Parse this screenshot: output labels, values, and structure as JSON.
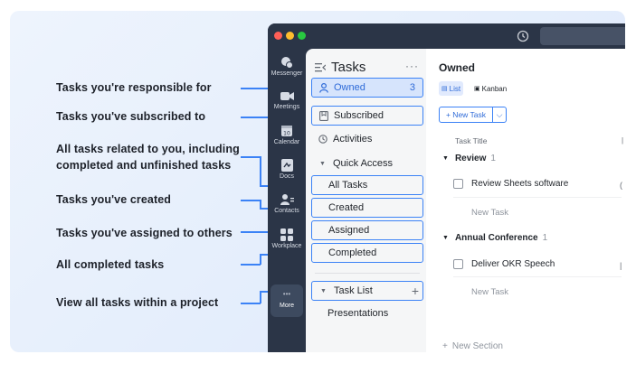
{
  "callouts": [
    "Tasks you're responsible for",
    "Tasks you've subscribed to",
    "All tasks related to you, including",
    "completed and unfinished tasks",
    "Tasks you've created",
    "Tasks you've assigned to others",
    "All completed tasks",
    "View all tasks within a project"
  ],
  "colors": {
    "accent": "#3b82f6",
    "traffic_red": "#ff5f57",
    "traffic_yellow": "#febc2e",
    "traffic_green": "#28c840"
  },
  "rail": {
    "items": [
      {
        "label": "Messenger",
        "icon": "messenger-icon"
      },
      {
        "label": "Meetings",
        "icon": "video-camera-icon"
      },
      {
        "label": "Calendar",
        "icon": "calendar-icon",
        "badge": "10"
      },
      {
        "label": "Docs",
        "icon": "docs-icon"
      },
      {
        "label": "Contacts",
        "icon": "contacts-icon"
      },
      {
        "label": "Workplace",
        "icon": "workplace-grid-icon"
      }
    ],
    "more_label": "More",
    "more_glyph": "•••"
  },
  "panel": {
    "title": "Tasks",
    "menu_glyph": "···",
    "owned": {
      "label": "Owned",
      "count": "3"
    },
    "subscribed": "Subscribed",
    "activities": "Activities",
    "quick_access": "Quick Access",
    "quick_items": [
      "All Tasks",
      "Created",
      "Assigned",
      "Completed"
    ],
    "task_list": "Task List",
    "add_glyph": "+",
    "projects": [
      "Presentations"
    ]
  },
  "main": {
    "title": "Owned",
    "tabs": [
      "List",
      "Kanban"
    ],
    "new_task_button": "+ New Task",
    "dropdown_glyph": "⌵",
    "column_header": "Task Title",
    "groups": [
      {
        "name": "Review",
        "count": "1",
        "tasks": [
          "Review Sheets software"
        ],
        "new_task": "New Task"
      },
      {
        "name": "Annual Conference",
        "count": "1",
        "tasks": [
          "Deliver OKR Speech"
        ],
        "new_task": "New Task"
      }
    ],
    "new_section": "New Section"
  }
}
